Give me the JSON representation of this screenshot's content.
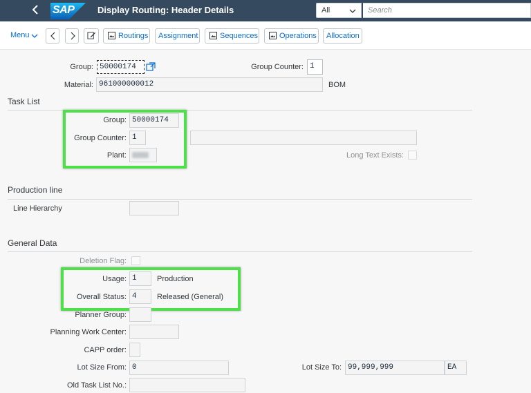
{
  "shell": {
    "title": "Display Routing: Header Details",
    "scope": "All",
    "search_placeholder": "Search",
    "logo_text": "SAP"
  },
  "toolbar": {
    "menu": "Menu",
    "routings": "Routings",
    "assignment": "Assignment",
    "sequences": "Sequences",
    "operations": "Operations",
    "allocation": "Allocation"
  },
  "header": {
    "group_label": "Group:",
    "group_value": "50000174",
    "group_counter_label": "Group Counter:",
    "group_counter_value": "1",
    "material_label": "Material:",
    "material_value": "961000000012",
    "bom": "BOM"
  },
  "task_list": {
    "title": "Task List",
    "group_label": "Group:",
    "group_value": "50000174",
    "group_counter_label": "Group Counter:",
    "group_counter_value": "1",
    "plant_label": "Plant:",
    "long_text_label": "Long Text Exists:"
  },
  "production_line": {
    "title": "Production line",
    "line_hierarchy_label": "Line Hierarchy"
  },
  "general_data": {
    "title": "General Data",
    "deletion_flag_label": "Deletion Flag:",
    "usage_label": "Usage:",
    "usage_value": "1",
    "usage_text": "Production",
    "status_label": "Overall Status:",
    "status_value": "4",
    "status_text": "Released (General)",
    "planner_group_label": "Planner Group:",
    "planning_wc_label": "Planning Work Center:",
    "capp_label": "CAPP order:",
    "lot_from_label": "Lot Size From:",
    "lot_from_value": "0",
    "lot_to_label": "Lot Size To:",
    "lot_to_value": "99,999,999",
    "unit": "EA",
    "old_task_label": "Old Task List No.:"
  },
  "colors": {
    "shell": "#354a5f",
    "accent": "#0a6ed1",
    "highlight": "#4de04a"
  }
}
